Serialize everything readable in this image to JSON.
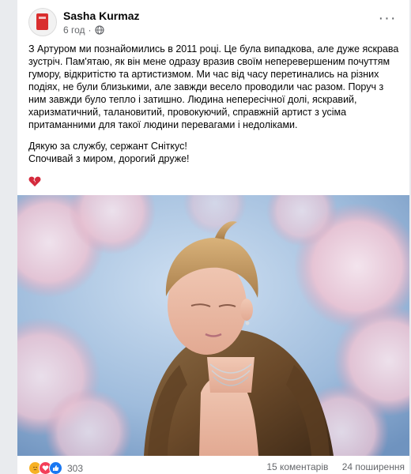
{
  "post": {
    "author": "Sasha Kurmaz",
    "time": "6 год",
    "separator": "·",
    "more_label": "···",
    "paragraph": "З Артуром ми познайомились в 2011 році. Це була випадкова, але дуже яскрава зустріч. Пам'ятаю, як він мене одразу вразив своїм неперевершеним почуттям гумору, відкритістю та артистизмом. Ми час від часу перетинались на різних подіях, не були близькими, але завжди весело проводили час разом. Поруч з ним завжди було тепло і затишно. Людина непересічної долі, яскравий, харизматичний, талановитий, провокуючий, справжній артист з усіма притаманними для такої людини перевагами і недоліками.",
    "closing_line1": "Дякую за службу, сержант Сніткус!",
    "closing_line2": "Спочивай з миром, дорогий друже!",
    "icon_heart": "broken-heart-icon",
    "icon_privacy": "globe-icon"
  },
  "footer": {
    "reaction_count": "303",
    "comments": "15 коментарів",
    "shares": "24 поширення",
    "reaction_icons": [
      "sad-emoji-icon",
      "love-emoji-icon",
      "like-icon"
    ]
  },
  "colors": {
    "text": "#050505",
    "secondary_text": "#65676b",
    "like_blue": "#1877f2",
    "love_red": "#f33e58",
    "heart_red": "#d42a3c"
  }
}
